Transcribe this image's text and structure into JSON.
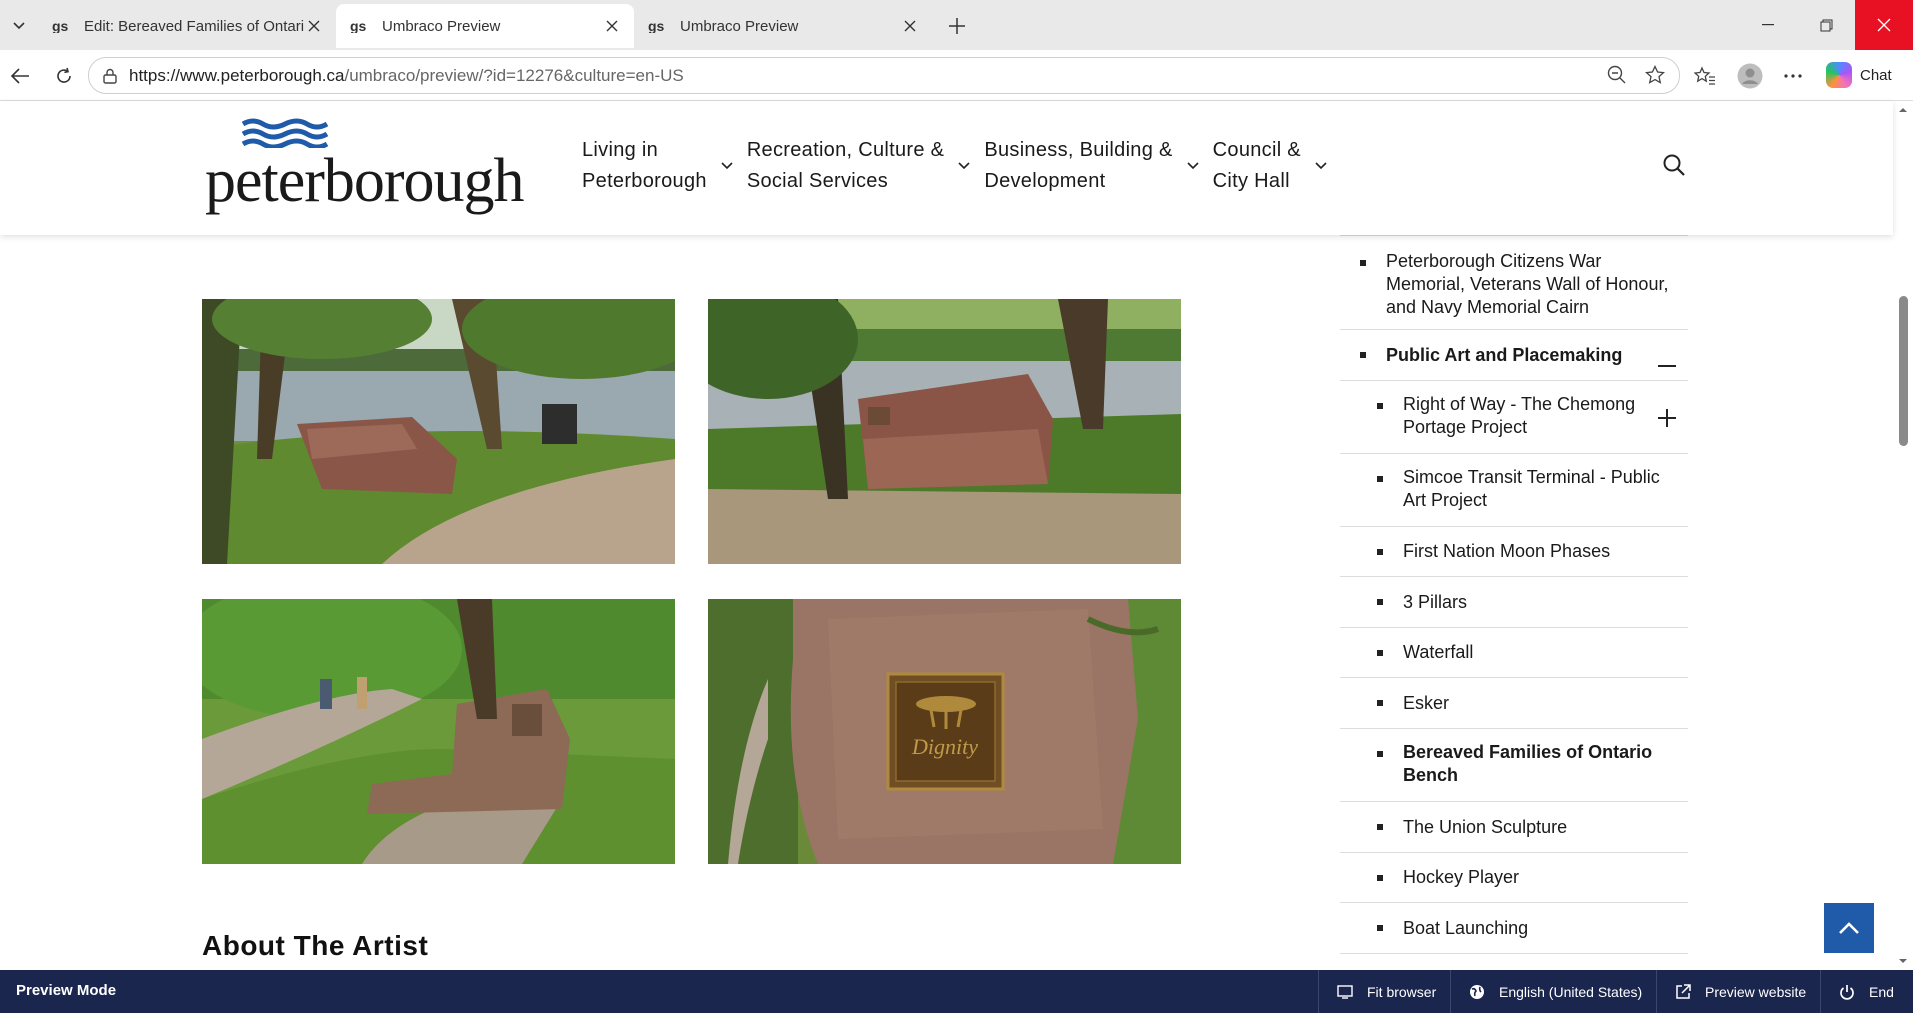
{
  "browser": {
    "tabs": [
      {
        "title": "Edit: Bereaved Families of Ontario",
        "active": false
      },
      {
        "title": "Umbraco Preview",
        "active": true
      },
      {
        "title": "Umbraco Preview",
        "active": false
      }
    ],
    "url_host": "https://www.peterborough.ca",
    "url_path": "/umbraco/preview/?id=12276&culture=en-US",
    "chat_label": "Chat"
  },
  "site": {
    "logo_text": "peterborough",
    "nav": [
      {
        "line1": "Living in",
        "line2": "Peterborough"
      },
      {
        "line1": "Recreation, Culture &",
        "line2": "Social Services"
      },
      {
        "line1": "Business, Building &",
        "line2": "Development"
      },
      {
        "line1": "Council &",
        "line2": "City Hall"
      }
    ]
  },
  "content": {
    "about_heading": "About The Artist"
  },
  "sidenav": {
    "items": [
      {
        "label": "Peterborough Citizens War Memorial, Veterans Wall of Honour, and Navy Memorial Cairn",
        "level": 1,
        "bold": false,
        "toggle": ""
      },
      {
        "label": "Public Art and Placemaking",
        "level": 1,
        "bold": true,
        "toggle": "minus"
      },
      {
        "label": "Right of Way - The Chemong Portage Project",
        "level": 2,
        "bold": false,
        "toggle": "plus"
      },
      {
        "label": "Simcoe Transit Terminal - Public Art Project",
        "level": 2,
        "bold": false,
        "toggle": ""
      },
      {
        "label": "First Nation Moon Phases",
        "level": 2,
        "bold": false,
        "toggle": ""
      },
      {
        "label": "3 Pillars",
        "level": 2,
        "bold": false,
        "toggle": ""
      },
      {
        "label": "Waterfall",
        "level": 2,
        "bold": false,
        "toggle": ""
      },
      {
        "label": "Esker",
        "level": 2,
        "bold": false,
        "toggle": ""
      },
      {
        "label": "Bereaved Families of Ontario Bench",
        "level": 2,
        "bold": true,
        "toggle": ""
      },
      {
        "label": "The Union Sculpture",
        "level": 2,
        "bold": false,
        "toggle": ""
      },
      {
        "label": "Hockey Player",
        "level": 2,
        "bold": false,
        "toggle": ""
      },
      {
        "label": "Boat Launching",
        "level": 2,
        "bold": false,
        "toggle": ""
      }
    ]
  },
  "preview_bar": {
    "mode_label": "Preview Mode",
    "fit_label": "Fit browser",
    "culture_label": "English (United States)",
    "preview_site_label": "Preview website",
    "end_label": "End"
  },
  "colors": {
    "brand_blue": "#1f5ba8",
    "preview_bar": "#1b264f",
    "close_red": "#e81123"
  }
}
